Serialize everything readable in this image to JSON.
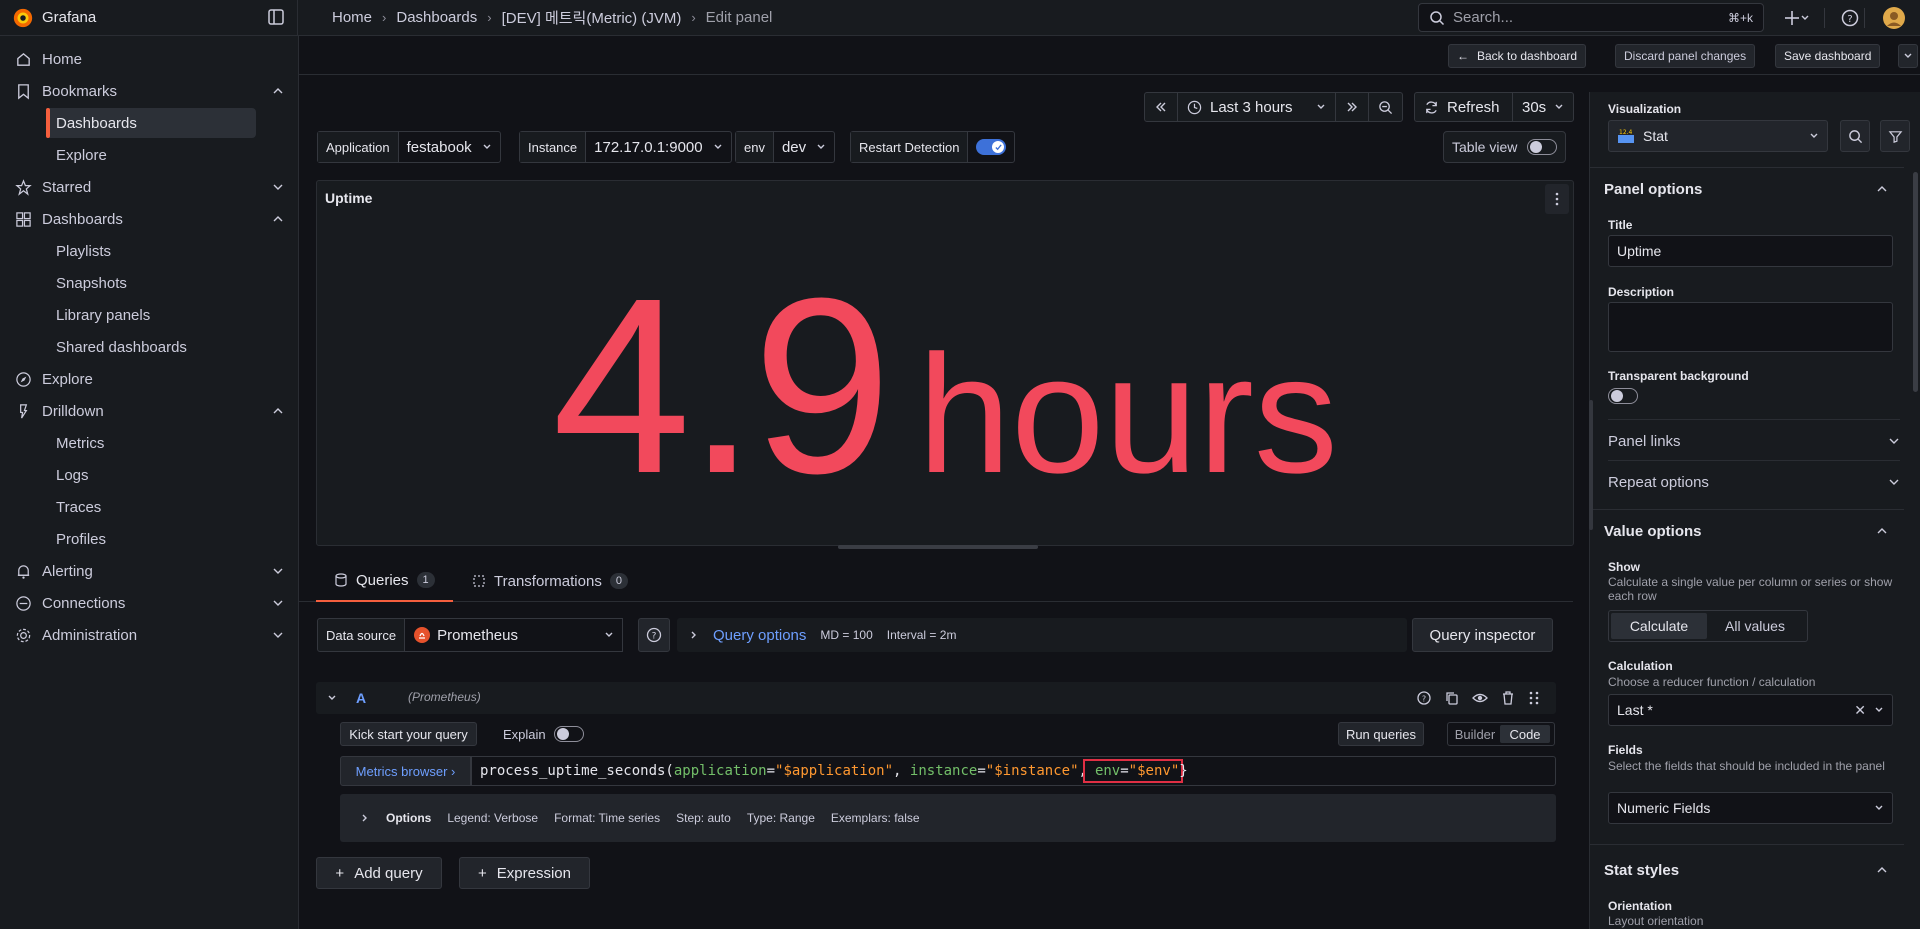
{
  "app": {
    "name": "Grafana"
  },
  "breadcrumb": [
    {
      "label": "Home"
    },
    {
      "label": "Dashboards"
    },
    {
      "label": "[DEV] 메트릭(Metric) (JVM)"
    },
    {
      "label": "Edit panel"
    }
  ],
  "search": {
    "placeholder": "Search...",
    "shortcut": "⌘+k"
  },
  "sidebar": {
    "home": "Home",
    "bookmarks": "Bookmarks",
    "dashboards_bm": "Dashboards",
    "explore_bm": "Explore",
    "starred": "Starred",
    "dashboards": "Dashboards",
    "playlists": "Playlists",
    "snapshots": "Snapshots",
    "library_panels": "Library panels",
    "shared_dashboards": "Shared dashboards",
    "explore": "Explore",
    "drilldown": "Drilldown",
    "metrics": "Metrics",
    "logs": "Logs",
    "traces": "Traces",
    "profiles": "Profiles",
    "alerting": "Alerting",
    "connections": "Connections",
    "administration": "Administration"
  },
  "subbar": {
    "back": "Back to dashboard",
    "discard": "Discard panel changes",
    "save": "Save dashboard"
  },
  "time": {
    "range": "Last 3 hours",
    "refresh": "Refresh",
    "interval": "30s"
  },
  "variables": {
    "application_label": "Application",
    "application_value": "festabook",
    "instance_label": "Instance",
    "instance_value": "172.17.0.1:9000",
    "env_label": "env",
    "env_value": "dev",
    "restart_label": "Restart Detection"
  },
  "table_view": "Table view",
  "panel": {
    "title": "Uptime",
    "value": "4.9",
    "unit": "hours"
  },
  "tabs": {
    "queries": "Queries",
    "queries_count": "1",
    "transformations": "Transformations",
    "transformations_count": "0"
  },
  "datasource": {
    "label": "Data source",
    "value": "Prometheus",
    "query_options": "Query options",
    "md": "MD = 100",
    "interval": "Interval = 2m",
    "inspector": "Query inspector"
  },
  "query": {
    "refid": "A",
    "ds_note": "(Prometheus)",
    "kickstart": "Kick start your query",
    "explain": "Explain",
    "run": "Run queries",
    "builder": "Builder",
    "code": "Code",
    "metrics_browser": "Metrics browser ›",
    "code_parts": {
      "fn": "process_uptime_seconds(",
      "l1": "application",
      "eq1": "=",
      "v1": "\"$application\"",
      "c1": ", ",
      "l2": "instance",
      "eq2": "=",
      "v2": "\"$instance\"",
      "c2": ",",
      "l3": "env",
      "eq3": "=",
      "v3": "\"$env\"",
      "close": "}"
    },
    "options_label": "Options",
    "options": [
      "Legend: Verbose",
      "Format: Time series",
      "Step: auto",
      "Type: Range",
      "Exemplars: false"
    ]
  },
  "actions": {
    "add_query": "Add query",
    "expression": "Expression"
  },
  "right": {
    "viz_label": "Visualization",
    "viz_value": "Stat",
    "panel_options": "Panel options",
    "title_label": "Title",
    "title_value": "Uptime",
    "description_label": "Description",
    "transparent_label": "Transparent background",
    "panel_links": "Panel links",
    "repeat_options": "Repeat options",
    "value_options": "Value options",
    "show_label": "Show",
    "show_desc": "Calculate a single value per column or series or show each row",
    "calculate": "Calculate",
    "all_values": "All values",
    "calc_label": "Calculation",
    "calc_desc": "Choose a reducer function / calculation",
    "calc_value": "Last *",
    "fields_label": "Fields",
    "fields_desc": "Select the fields that should be included in the panel",
    "fields_value": "Numeric Fields",
    "stat_styles": "Stat styles",
    "orientation_label": "Orientation",
    "orientation_desc": "Layout orientation"
  },
  "colors": {
    "accent": "#f55f3e",
    "stat": "#f2495c",
    "primary": "#3d71d9",
    "highlight": "#e02f44"
  }
}
